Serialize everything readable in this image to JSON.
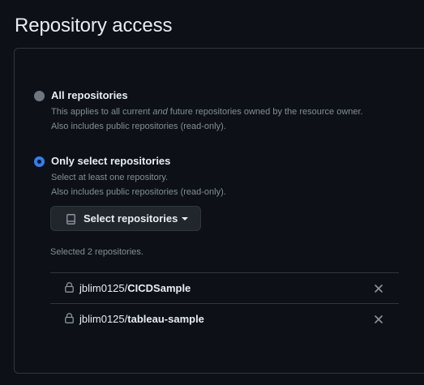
{
  "section": {
    "title": "Repository access"
  },
  "options": [
    {
      "label": "All repositories",
      "selected": false,
      "description_before_em": "This applies to all current ",
      "description_em": "and",
      "description_after_em": " future repositories owned by the resource owner.",
      "note": "Also includes public repositories (read-only)."
    },
    {
      "label": "Only select repositories",
      "selected": true,
      "description": "Select at least one repository.",
      "note": "Also includes public repositories (read-only)."
    }
  ],
  "select_button": {
    "label": "Select repositories",
    "icon": "repo-icon"
  },
  "selected_count_text": "Selected 2 repositories.",
  "repositories": [
    {
      "owner": "jblim0125/",
      "name": "CICDSample"
    },
    {
      "owner": "jblim0125/",
      "name": "tableau-sample"
    }
  ],
  "colors": {
    "background": "#0d1117",
    "border": "#30363d",
    "text": "#e6edf3",
    "muted": "#848d97",
    "accent": "#2f81f7",
    "button_bg": "#21262d"
  }
}
